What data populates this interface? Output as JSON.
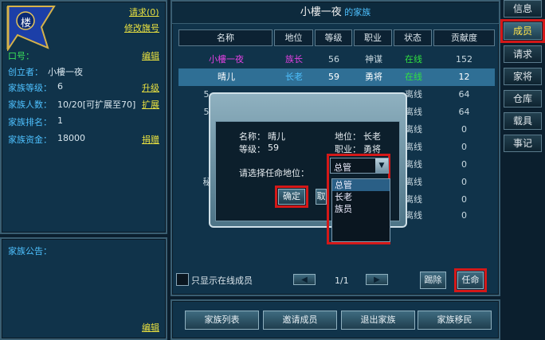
{
  "left": {
    "emblem_char": "楼",
    "request_link": "请求(0)",
    "modify_flag_link": "修改旗号",
    "slogan_label": "口号：",
    "edit_link": "编辑",
    "creator_label": "创立者：",
    "creator_value": "小樓一夜",
    "level_label": "家族等级：",
    "level_value": "6",
    "upgrade_link": "升级",
    "members_label": "家族人数：",
    "members_value": "10/20[可扩展至70]",
    "expand_link": "扩展",
    "rank_label": "家族排名：",
    "rank_value": "1",
    "funds_label": "家族资金：",
    "funds_value": "18000",
    "donate_link": "捐赠",
    "notice_label": "家族公告：",
    "notice_edit_link": "编辑"
  },
  "header": {
    "family_name": "小樓一夜",
    "family_suffix": "的家族"
  },
  "table": {
    "columns": [
      "名称",
      "地位",
      "等级",
      "职业",
      "状态",
      "贡献度"
    ],
    "rows": [
      {
        "name": "小樓一夜",
        "role": "族长",
        "level": "56",
        "job": "神谋",
        "status": "在线",
        "contrib": "152"
      },
      {
        "name": "晴儿",
        "role": "长老",
        "level": "59",
        "job": "勇将",
        "status": "在线",
        "contrib": "12"
      },
      {
        "name": "5",
        "role": "",
        "level": "",
        "job": "",
        "status": "离线",
        "contrib": "64"
      },
      {
        "name": "5",
        "role": "",
        "level": "",
        "job": "",
        "status": "离线",
        "contrib": "64"
      },
      {
        "name": "",
        "role": "",
        "level": "",
        "job": "",
        "status": "离线",
        "contrib": "0"
      },
      {
        "name": "",
        "role": "",
        "level": "",
        "job": "",
        "status": "离线",
        "contrib": "0"
      },
      {
        "name": "",
        "role": "",
        "level": "",
        "job": "",
        "status": "离线",
        "contrib": "0"
      },
      {
        "name": "秘",
        "role": "",
        "level": "",
        "job": "",
        "status": "离线",
        "contrib": "0"
      },
      {
        "name": "",
        "role": "",
        "level": "",
        "job": "",
        "status": "离线",
        "contrib": "0"
      },
      {
        "name": "",
        "role": "",
        "level": "",
        "job": "",
        "status": "离线",
        "contrib": "0"
      }
    ],
    "online_only_label": "只显示在线成员",
    "page": "1/1",
    "kick_button": "踢除",
    "appoint_button": "任命"
  },
  "dialog": {
    "name_label": "名称：",
    "name_value": "晴儿",
    "level_label": "等级：",
    "level_value": "59",
    "role_label": "地位：",
    "role_value": "长老",
    "job_label": "职业：",
    "job_value": "勇将",
    "prompt": "请选择任命地位：",
    "selected": "总管",
    "options": [
      "总管",
      "长老",
      "族员"
    ],
    "confirm": "确定",
    "cancel": "取"
  },
  "bottom": {
    "family_list": "家族列表",
    "invite": "邀请成员",
    "quit": "退出家族",
    "migrate": "家族移民"
  },
  "side_tabs": [
    "信息",
    "成员",
    "请求",
    "家将",
    "仓库",
    "载具",
    "事记"
  ],
  "colors": {
    "label_blue": "#4ec1ff",
    "link_yellow": "#e8e040",
    "leader_magenta": "#e040e0",
    "online_green": "#30e040",
    "highlight_red": "#d41818",
    "selected_row": "#2f6f95"
  }
}
